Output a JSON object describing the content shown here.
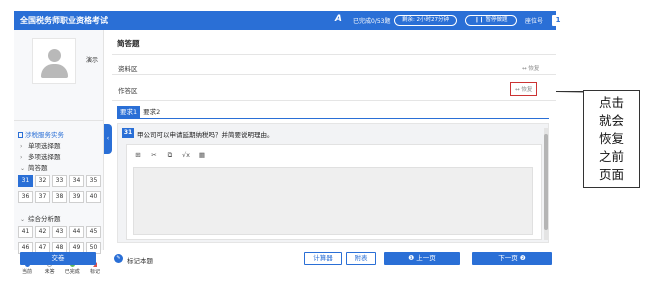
{
  "header": {
    "title": "全国税务师职业资格考试",
    "font_icon": "A",
    "answered": "已完成0/53题",
    "timer": "剩余: 2小时27分钟",
    "pause_label": "暂停做题",
    "seat_label": "座位号",
    "seat_number": "1"
  },
  "user": {
    "name": "演示"
  },
  "nav": {
    "section": "涉税服务实务",
    "groups": [
      {
        "label": "单项选择题",
        "arrow": "›"
      },
      {
        "label": "多项选择题",
        "arrow": "›"
      },
      {
        "label": "简答题",
        "arrow": "⌄"
      },
      {
        "label": "综合分析题",
        "arrow": "⌄"
      }
    ],
    "short_answer_numbers": [
      "31",
      "32",
      "33",
      "34",
      "35",
      "36",
      "37",
      "38",
      "39",
      "40"
    ],
    "analysis_numbers": [
      "41",
      "42",
      "43",
      "44",
      "45",
      "46",
      "47",
      "48",
      "49",
      "50"
    ],
    "current": "31"
  },
  "legend": [
    {
      "label": "当前",
      "color": "#2a6fd6"
    },
    {
      "label": "未答",
      "color": "#ffffff"
    },
    {
      "label": "已完成",
      "color": "#5cb85c"
    },
    {
      "label": "标记",
      "color": "#d9534f"
    }
  ],
  "main": {
    "question_type": "简答题",
    "material_label": "资料区",
    "restore_label": "↔ 恢复",
    "work_label": "作答区",
    "tabs": [
      "要求1",
      "要求2"
    ],
    "question_number": "31",
    "question_text": "甲公司可以申请延期纳税吗？并简要说明理由。",
    "toolbar": [
      "⊞",
      "✂",
      "⧉",
      "√x",
      "▦"
    ]
  },
  "footer": {
    "submit_label": "交卷",
    "flag_label": "标记本题",
    "calculator_label": "计算器",
    "appendix_label": "附表",
    "prev_label": "❶ 上一页",
    "next_label": "下一页 ❷"
  },
  "annotation": {
    "lines": [
      "点击",
      "就会",
      "恢复",
      "之前",
      "页面"
    ]
  },
  "colors": {
    "primary": "#2a6fd6",
    "annotation_border": "#cc3333"
  }
}
